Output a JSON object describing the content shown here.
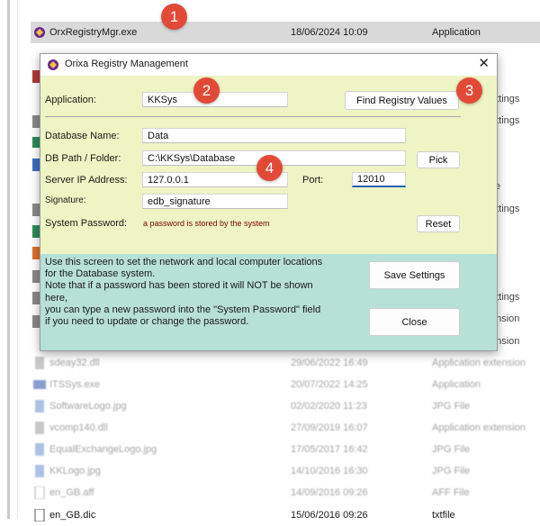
{
  "explorer": {
    "selected_row": {
      "name": "OrxRegistryMgr.exe",
      "date": "18/06/2024 10:09",
      "type": "Application"
    },
    "peek_types": [
      "ettings",
      "ettings",
      "ile",
      "ettings",
      "ettings",
      "ension",
      "ension"
    ],
    "rows": [
      {
        "name": "sdeay32.dll",
        "date": "29/06/2022 16:49",
        "type": "Application extension"
      },
      {
        "name": "ITSSys.exe",
        "date": "20/07/2022 14:25",
        "type": "Application"
      },
      {
        "name": "SoftwareLogo.jpg",
        "date": "02/02/2020 11:23",
        "type": "JPG File"
      },
      {
        "name": "vcomp140.dll",
        "date": "27/09/2019 16:07",
        "type": "Application extension"
      },
      {
        "name": "EqualExchangeLogo.jpg",
        "date": "17/05/2017 16:42",
        "type": "JPG File"
      },
      {
        "name": "KKLogo.jpg",
        "date": "14/10/2016 16:30",
        "type": "JPG File"
      },
      {
        "name": "en_GB.aff",
        "date": "14/09/2016 09:26",
        "type": "AFF File"
      },
      {
        "name": "en_GB.dic",
        "date": "15/06/2016 09:26",
        "type": "txtfile"
      }
    ]
  },
  "dialog": {
    "title": "Orixa Registry Management",
    "application_label": "Application:",
    "application_value": "KKSys",
    "find_button": "Find Registry Values",
    "db_name_label": "Database Name:",
    "db_name_value": "Data",
    "db_path_label": "DB Path / Folder:",
    "db_path_value": "C:\\KKSys\\Database",
    "pick_button": "Pick",
    "server_ip_label": "Server IP Address:",
    "server_ip_value": "127.0.0.1",
    "port_label": "Port:",
    "port_value": "12010",
    "signature_label": "Signature:",
    "signature_value": "edb_signature",
    "password_label": "System Password:",
    "password_note": "a password is stored by the system",
    "reset_button": "Reset",
    "info_lines": [
      "Use this screen to set the network and local computer locations",
      "for the Database system.",
      "Note that if a password has been stored it will NOT be shown",
      "here,",
      "you can type a new password into the \"System Password\" field",
      "if you need to update or change the password."
    ],
    "save_button": "Save Settings",
    "close_button": "Close"
  },
  "callouts": [
    "1",
    "2",
    "3",
    "4"
  ],
  "colors": {
    "dialog_bg": "#eef4c4",
    "info_bg": "#b7e0d6",
    "callout": "#e24a37",
    "focus": "#1a5fb4"
  }
}
